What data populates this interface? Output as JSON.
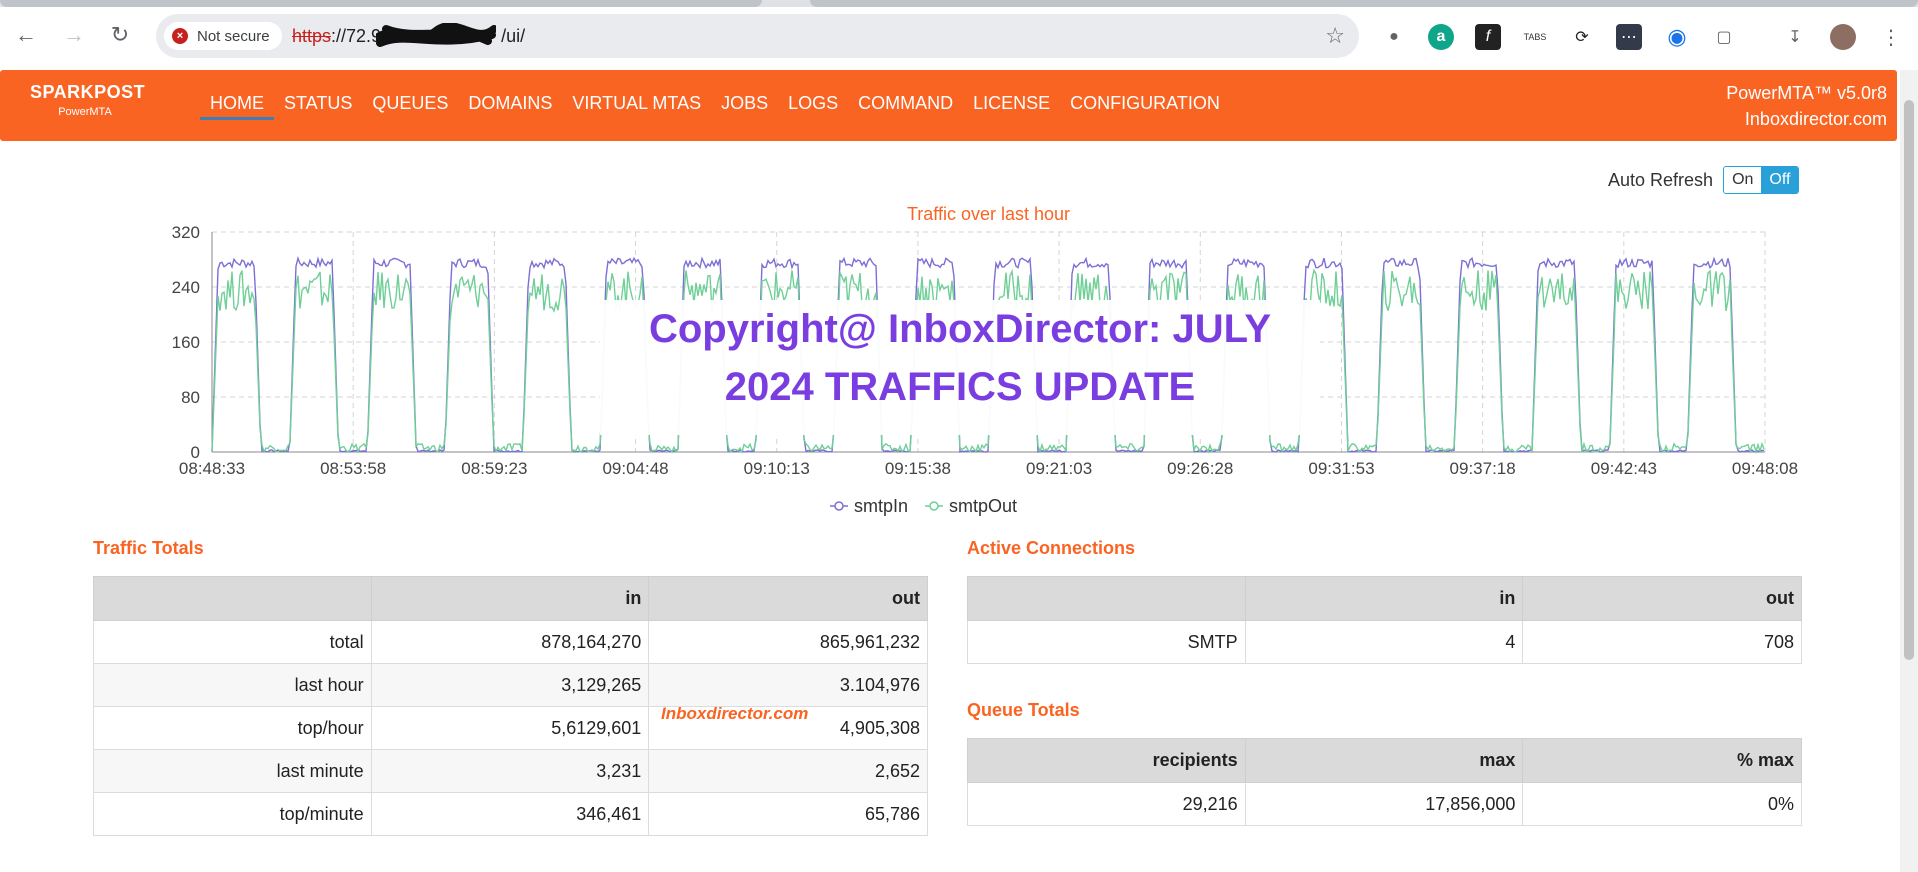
{
  "browser": {
    "security_label": "Not secure",
    "url_scheme": "https",
    "url_prefix": "://72.9",
    "url_suffix": "/ui/"
  },
  "app": {
    "brand": "SPARKPOST",
    "brand_sub": "PowerMTA",
    "menu": [
      "HOME",
      "STATUS",
      "QUEUES",
      "DOMAINS",
      "VIRTUAL MTAS",
      "JOBS",
      "LOGS",
      "COMMAND",
      "LICENSE",
      "CONFIGURATION"
    ],
    "active_menu": "HOME",
    "version": "PowerMTA™ v5.0r8",
    "site": "Inboxdirector.com"
  },
  "auto_refresh": {
    "label": "Auto Refresh",
    "on": "On",
    "off": "Off",
    "selected": "Off"
  },
  "watermark": {
    "line1": "Copyright@ InboxDirector: JULY",
    "line2": "2024 TRAFFICS UPDATE",
    "small": "Inboxdirector.com"
  },
  "chart_data": {
    "type": "line",
    "title": "Traffic over last hour",
    "x": [
      "08:48:33",
      "08:53:58",
      "08:59:23",
      "09:04:48",
      "09:10:13",
      "09:15:38",
      "09:21:03",
      "09:26:28",
      "09:31:53",
      "09:37:18",
      "09:42:43",
      "09:48:08"
    ],
    "ylim": [
      0,
      320
    ],
    "yticks": [
      0,
      80,
      160,
      240,
      320
    ],
    "grid": true,
    "legend_position": "bottom",
    "series": [
      {
        "name": "smtpIn",
        "color": "#7b6fd6",
        "peak": 275,
        "cycles": 20
      },
      {
        "name": "smtpOut",
        "color": "#6fcf97",
        "peak": 235,
        "cycles": 20
      }
    ]
  },
  "traffic_totals": {
    "title": "Traffic Totals",
    "headers": [
      "",
      "in",
      "out"
    ],
    "rows": [
      [
        "total",
        "878,164,270",
        "865,961,232"
      ],
      [
        "last hour",
        "3,129,265",
        "3.104,976"
      ],
      [
        "top/hour",
        "5,6129,601",
        "4,905,308"
      ],
      [
        "last minute",
        "3,231",
        "2,652"
      ],
      [
        "top/minute",
        "346,461",
        "65,786"
      ]
    ]
  },
  "active_connections": {
    "title": "Active Connections",
    "headers": [
      "",
      "in",
      "out"
    ],
    "rows": [
      [
        "SMTP",
        "4",
        "708"
      ]
    ]
  },
  "queue_totals": {
    "title": "Queue Totals",
    "headers": [
      "recipients",
      "max",
      "% max"
    ],
    "rows": [
      [
        "29,216",
        "17,856,000",
        "0%"
      ]
    ]
  }
}
